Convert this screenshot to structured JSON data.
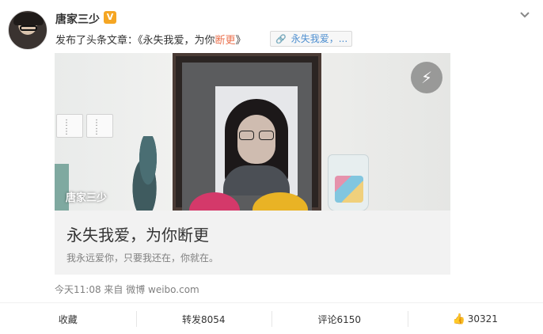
{
  "post": {
    "author": "唐家三少",
    "verified_badge": "V",
    "intro_prefix": "发布了头条文章：《永失我爱，为你",
    "intro_highlight": "断更",
    "intro_suffix": "》",
    "link_chip": "永失我爱，...",
    "card": {
      "watermark": "唐家三少",
      "title": "永失我爱，为你断更",
      "description": "我永远爱你，只要我还在，你就在。"
    },
    "meta": "今天11:08 来自 微博 weibo.com"
  },
  "actions": {
    "favorite": "收藏",
    "repost": "转发8054",
    "comment": "评论6150",
    "like": "30321"
  },
  "icons": {
    "dropdown": "chevron-down-icon",
    "link": "link-icon",
    "flash": "lightning-icon",
    "like": "thumbs-up-icon"
  },
  "colors": {
    "highlight": "#eb7350",
    "link": "#4e8fd0",
    "badge": "#f5a623"
  }
}
